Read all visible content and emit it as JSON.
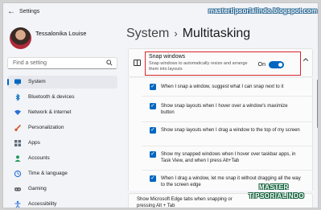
{
  "titlebar": {
    "title": "Settings",
    "back_icon": "back-arrow-icon"
  },
  "watermark": "mastertipsorialindo.blogspot.com",
  "user": {
    "name": "Tessalonika Louise",
    "email": ""
  },
  "search": {
    "placeholder": "Find a setting"
  },
  "nav": [
    {
      "label": "System",
      "icon": "monitor-icon",
      "color": "#0067c0",
      "active": true
    },
    {
      "label": "Bluetooth & devices",
      "icon": "bluetooth-icon",
      "color": "#0067c0"
    },
    {
      "label": "Network & internet",
      "icon": "wifi-icon",
      "color": "#2a6fd6"
    },
    {
      "label": "Personalization",
      "icon": "brush-icon",
      "color": "#d65a2a"
    },
    {
      "label": "Apps",
      "icon": "apps-icon",
      "color": "#5b6b7b"
    },
    {
      "label": "Accounts",
      "icon": "person-icon",
      "color": "#1f9a5a"
    },
    {
      "label": "Time & language",
      "icon": "globe-clock-icon",
      "color": "#2a6fd6"
    },
    {
      "label": "Gaming",
      "icon": "gamepad-icon",
      "color": "#666666"
    },
    {
      "label": "Accessibility",
      "icon": "accessibility-icon",
      "color": "#2a6fd6"
    }
  ],
  "header": {
    "parent": "System",
    "separator": "›",
    "current": "Multitasking"
  },
  "snap": {
    "title": "Snap windows",
    "description": "Snap windows to automatically resize and arrange them into layouts",
    "toggle_label": "On",
    "toggle_on": true
  },
  "options": [
    {
      "text": "When I snap a window, suggest what I can snap next to it",
      "checked": true
    },
    {
      "text": "Show snap layouts when I hover over a window's maximize button",
      "checked": true
    },
    {
      "text": "Show snap layouts when I drag a window to the top of my screen",
      "checked": true
    },
    {
      "text": "Show my snapped windows when I hover over taskbar apps, in Task View, and when I press Alt+Tab",
      "checked": true
    },
    {
      "text": "When I drag a window, let me snap it without dragging all the way to the screen edge",
      "checked": true
    }
  ],
  "bottom": {
    "text": "Show Microsoft Edge tabs when snapping or pressing Alt + Tab"
  },
  "logo": {
    "line1": "MASTER",
    "line2": "TIPSORIALINDO"
  },
  "colors": {
    "accent": "#0067c0",
    "highlight": "#d8252b"
  }
}
